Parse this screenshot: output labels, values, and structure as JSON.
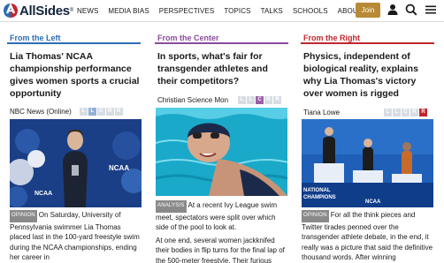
{
  "header": {
    "logo_text": "AllSides",
    "logo_mark": "®",
    "nav": [
      "NEWS",
      "MEDIA BIAS",
      "PERSPECTIVES",
      "TOPICS",
      "TALKS",
      "SCHOOLS",
      "ABOUT"
    ],
    "join_label": "Join",
    "icons": [
      "user-icon",
      "search-icon",
      "menu-icon"
    ]
  },
  "columns": {
    "left": {
      "heading": "From the Left",
      "heading_color": "#2c6db5",
      "headline": "Lia Thomas' NCAA championship performance gives women sports a crucial opportunity",
      "source": "NBC News (Online)",
      "bias_letters": [
        "L",
        "L",
        "C",
        "R",
        "R"
      ],
      "bias_active": "lean-left",
      "tag": "OPINION",
      "snippet": "On Saturday, University of Pennsylvania swimmer Lia Thomas placed last in the 100-yard freestyle swim during the NCAA championships, ending her career in"
    },
    "center": {
      "heading": "From the Center",
      "heading_color": "#8a4b9a",
      "headline": "In sports, what's fair for transgender athletes and their competitors?",
      "source": "Christian Science Mon",
      "bias_letters": [
        "L",
        "L",
        "C",
        "R",
        "R"
      ],
      "bias_active": "center",
      "tag": "ANALYSIS",
      "snippet_1": "At a recent Ivy League swim meet, spectators were split over which side of the pool to look at.",
      "snippet_2": "At one end, several women jackknifed their bodies in flip turns for the final lap of the 500-meter freestyle. Their furious"
    },
    "right": {
      "heading": "From the Right",
      "heading_color": "#c0272d",
      "headline": "Physics, independent of biological reality, explains why Lia Thomas's victory over women is rigged",
      "source": "Tiana Lowe",
      "bias_letters": [
        "L",
        "L",
        "C",
        "R",
        "R"
      ],
      "bias_active": "right",
      "tag": "OPINION",
      "snippet": "For all the think pieces and Twitter tirades penned over the transgender athlete debate, in the end, it really was a picture that said the definitive thousand words. After winning"
    }
  }
}
